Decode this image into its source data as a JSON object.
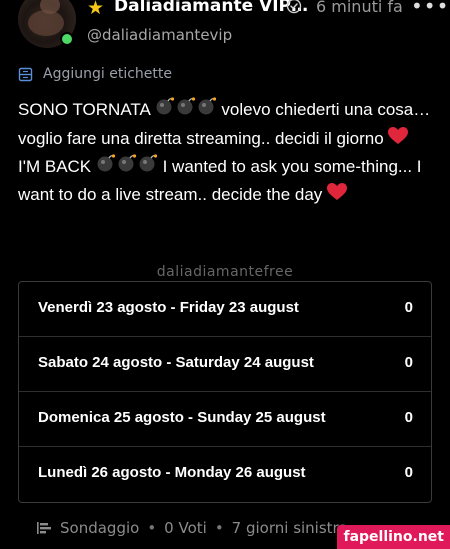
{
  "header": {
    "display_name": "Daliadiamante VIP…",
    "username": "@daliadiamantevip",
    "time": "6 minuti fa",
    "more": "•••"
  },
  "tags": {
    "label": "Aggiungi etichette"
  },
  "post": {
    "line1_a": "SONO TORNATA",
    "line1_b": " volevo chiederti una cosa… voglio fare una diretta streaming.. decidi il giorno ",
    "line2_a": "I'M BACK",
    "line2_b": " I wanted to ask you some-thing... I want to do a live stream.. decide the day"
  },
  "watermark": "daliadiamantefree",
  "poll": {
    "options": [
      {
        "label": "Venerdì 23 agosto - Friday 23 august",
        "votes": "0"
      },
      {
        "label": "Sabato 24 agosto - Saturday 24 august",
        "votes": "0"
      },
      {
        "label": "Domenica 25 agosto - Sunday 25 august",
        "votes": "0"
      },
      {
        "label": "Lunedì 26 agosto - Monday 26 august",
        "votes": "0"
      }
    ],
    "footer": {
      "type": "Sondaggio",
      "votes": "0 Voti",
      "remaining": "7 giorni sinistra"
    }
  },
  "site_watermark": "fapellino.net",
  "colors": {
    "accent": "#e0195b",
    "online": "#4cd964",
    "star": "#f5c518"
  }
}
